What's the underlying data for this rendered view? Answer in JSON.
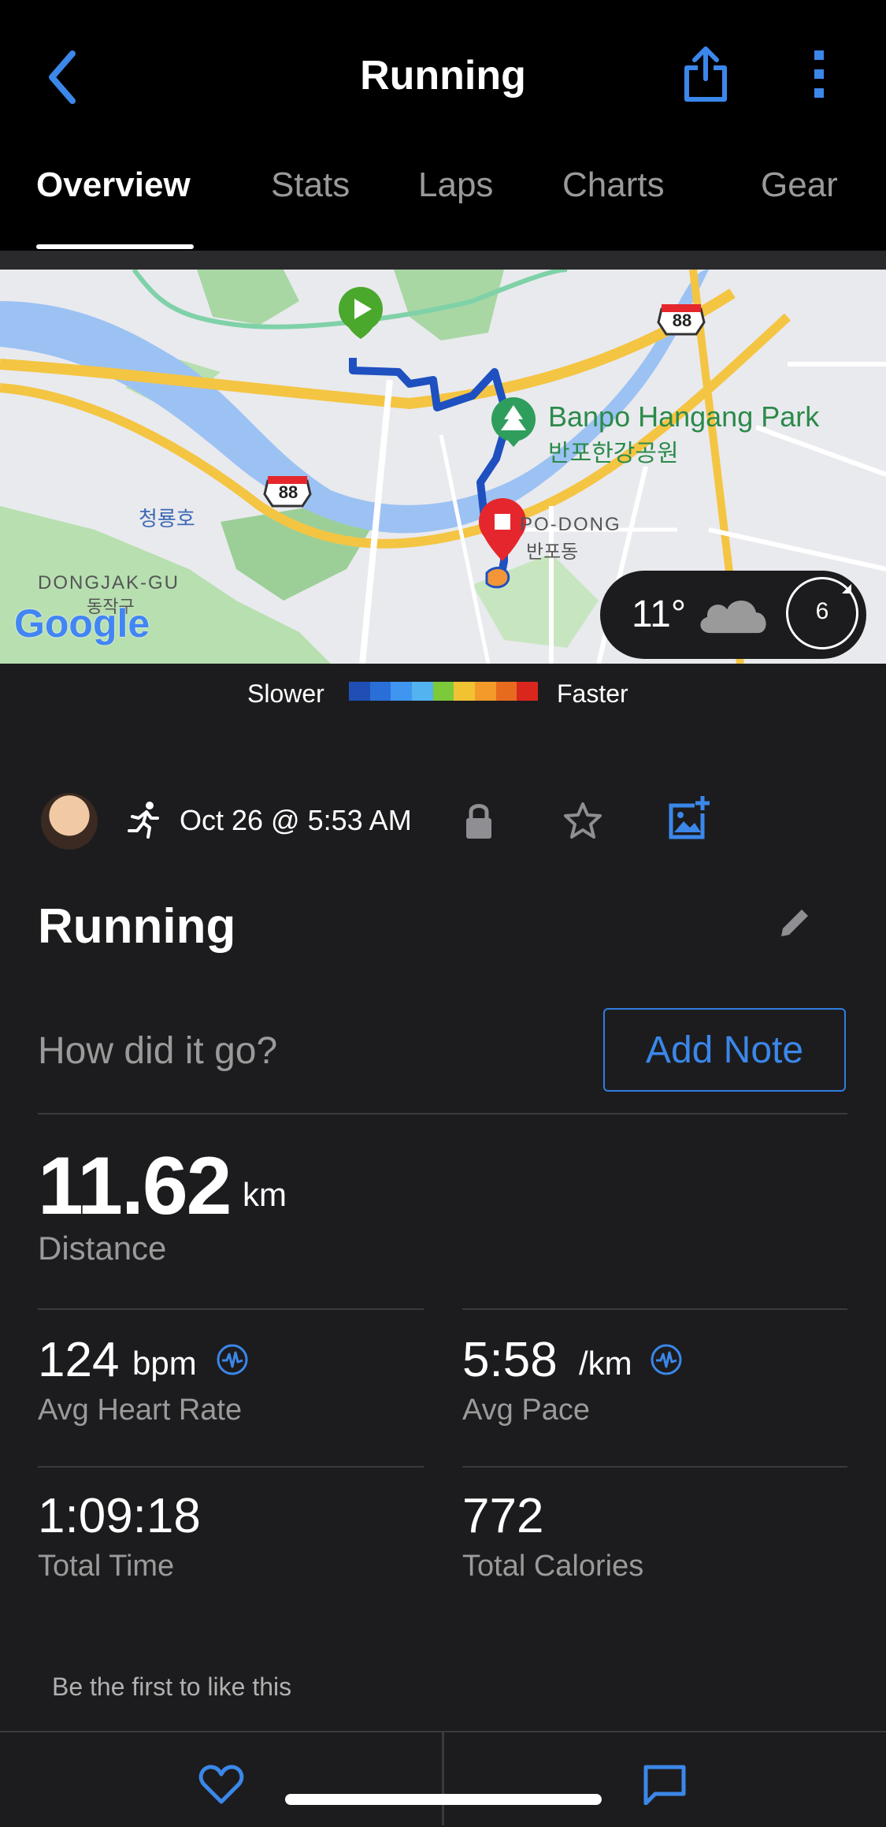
{
  "header": {
    "title": "Running"
  },
  "tabs": [
    {
      "label": "Overview"
    },
    {
      "label": "Stats"
    },
    {
      "label": "Laps"
    },
    {
      "label": "Charts"
    },
    {
      "label": "Gear"
    }
  ],
  "map": {
    "park_name": "Banpo Hangang Park",
    "park_name_ko": "반포한강공원",
    "district_en": "DONGJAK-GU",
    "district_ko": "동작구",
    "neighborhood_en": "PO-DONG",
    "neighborhood_ko": "반포동",
    "lake_ko": "청룡호",
    "route_shield_1": "88",
    "route_shield_2": "88",
    "brand": "Google",
    "weather_temp": "11°",
    "wind_value": "6"
  },
  "legend": {
    "slower": "Slower",
    "faster": "Faster",
    "colors": [
      "#1f4fb4",
      "#2a6fd8",
      "#3f95f0",
      "#53b2f0",
      "#7cc93a",
      "#f1c232",
      "#f39a2a",
      "#e76b1f",
      "#d9271e"
    ]
  },
  "meta": {
    "date": "Oct 26 @ 5:53 AM"
  },
  "activity": {
    "name": "Running",
    "note_prompt": "How did it go?",
    "add_note_label": "Add Note"
  },
  "stats": {
    "distance": {
      "value": "11.62",
      "unit": "km",
      "label": "Distance"
    },
    "heart_rate": {
      "value": "124",
      "unit": "bpm",
      "label": "Avg Heart Rate"
    },
    "pace": {
      "value": "5:58",
      "unit": "/km",
      "label": "Avg Pace"
    },
    "time": {
      "value": "1:09:18",
      "label": "Total Time"
    },
    "calories": {
      "value": "772",
      "label": "Total Calories"
    }
  },
  "social": {
    "likes_text": "Be the first to like this"
  },
  "icons": [
    "back-chevron-icon",
    "share-icon",
    "more-vertical-icon",
    "runner-icon",
    "lock-icon",
    "star-icon",
    "add-photo-icon",
    "pencil-icon",
    "pulse-icon",
    "heart-icon",
    "comment-icon",
    "cloud-icon"
  ],
  "colors": {
    "accent": "#2f7de1",
    "background": "#1c1c1e",
    "header": "#000000"
  }
}
